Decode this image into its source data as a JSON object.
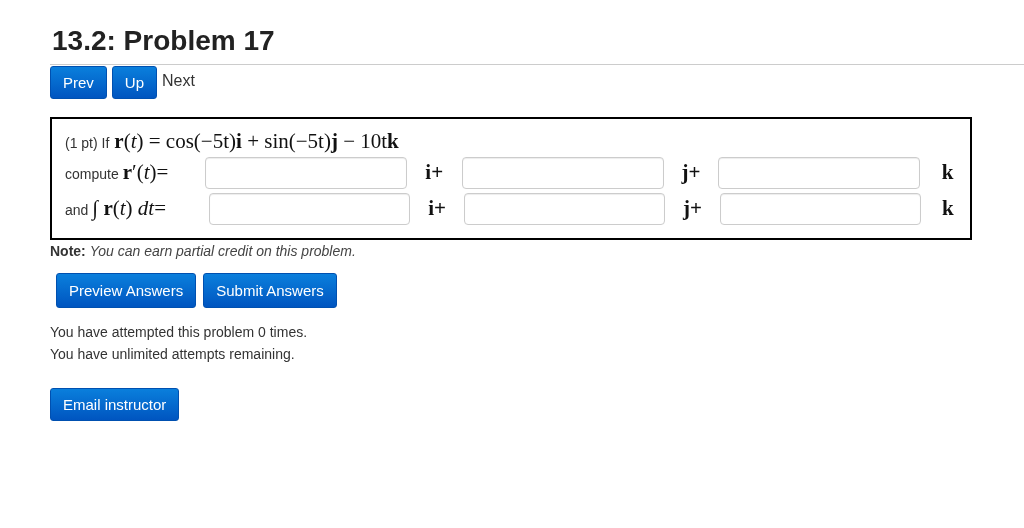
{
  "title": "13.2: Problem 17",
  "nav": [
    {
      "label": "Prev",
      "kind": "button"
    },
    {
      "label": "Up",
      "kind": "button"
    },
    {
      "label": "Next",
      "kind": "text"
    }
  ],
  "problem": {
    "points": "(1 pt) If",
    "formula": "**r**(*t*) = cos(−5t)**i** + sin(−5t)**j** − 10t**k**",
    "rows": [
      {
        "label": "compute",
        "math": "**r**′(*t*)=",
        "blanks": [
          {
            "suffix": "i+"
          },
          {
            "suffix": "j+"
          },
          {
            "suffix": "k"
          }
        ]
      },
      {
        "label": "and",
        "math": "∫ **r**(*t*) *dt*=",
        "blanks": [
          {
            "suffix": "i+"
          },
          {
            "suffix": "j+"
          },
          {
            "suffix": "k"
          }
        ]
      }
    ]
  },
  "note": {
    "label": "Note:",
    "text": "You can earn partial credit on this problem."
  },
  "actions": [
    "Preview Answers",
    "Submit Answers"
  ],
  "status": [
    "You have attempted this problem 0 times.",
    "You have unlimited attempts remaining."
  ],
  "email": "Email instructor"
}
